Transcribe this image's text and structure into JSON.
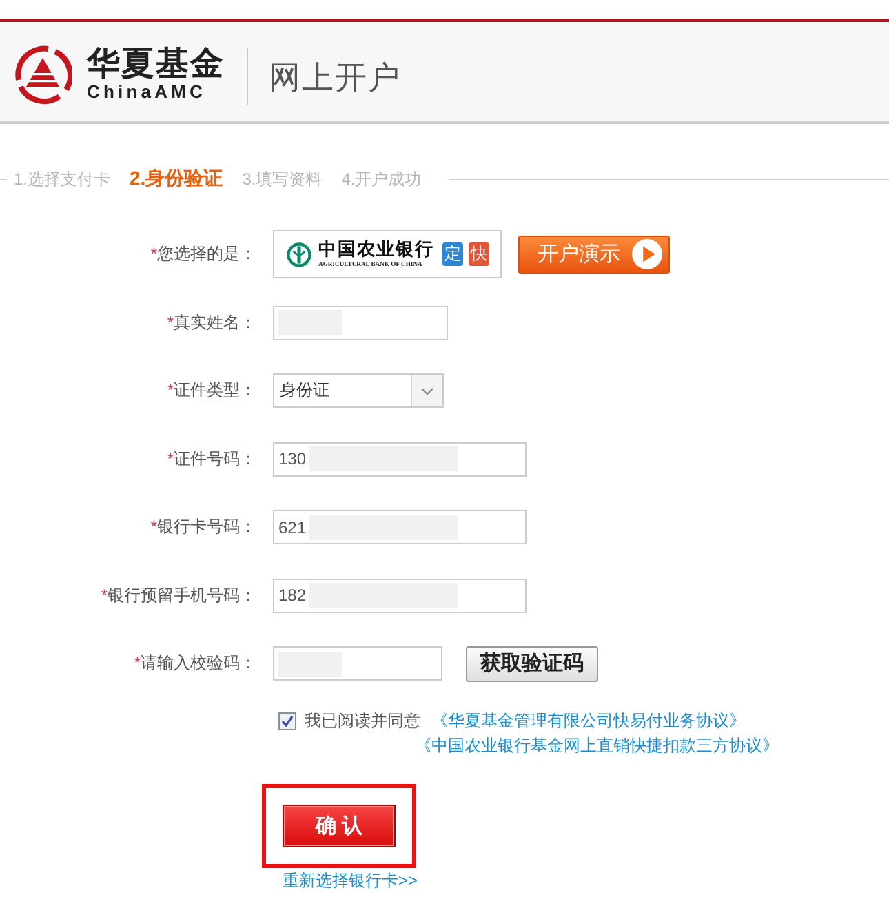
{
  "header": {
    "logo_title": "华夏基金",
    "logo_subtitle": "ChinaAMC",
    "page_title": "网上开户"
  },
  "steps": [
    {
      "label": "1.选择支付卡",
      "selected": false
    },
    {
      "label": "2.身份验证",
      "selected": true
    },
    {
      "label": "3.填写资料",
      "selected": false
    },
    {
      "label": "4.开户成功",
      "selected": false
    }
  ],
  "form": {
    "fields": [
      {
        "kind": "bank",
        "required_mark": "*",
        "label": "您选择的是：",
        "bank_name": "中国农业银行",
        "bank_name_en": "AGRICULTURAL BANK OF CHINA",
        "badges": [
          {
            "text": "定",
            "color": "#2b86d6"
          },
          {
            "text": "快",
            "color": "#e05636"
          }
        ],
        "button": "开户演示"
      },
      {
        "kind": "short_text",
        "required_mark": "*",
        "label": "真实姓名：",
        "masked": true
      },
      {
        "kind": "select",
        "required_mark": "*",
        "label": "证件类型：",
        "value": "身份证"
      },
      {
        "kind": "text",
        "required_mark": "*",
        "label": "证件号码：",
        "value": "130",
        "masked": true
      },
      {
        "kind": "text",
        "required_mark": "*",
        "label": "银行卡号码：",
        "value": "621",
        "masked": true
      },
      {
        "kind": "text",
        "required_mark": "*",
        "label": "银行预留手机号码：",
        "value": "182",
        "masked": true
      },
      {
        "kind": "code",
        "required_mark": "*",
        "label": "请输入校验码：",
        "masked": true,
        "button": "获取验证码"
      }
    ]
  },
  "agreement": {
    "checked": true,
    "text": "我已阅读并同意",
    "links": [
      "《华夏基金管理有限公司快易付业务协议》",
      "《中国农业银行基金网上直销快捷扣款三方协议》"
    ]
  },
  "confirm": {
    "label": "确 认",
    "highlighted": true,
    "reselect_link": "重新选择银行卡>>"
  }
}
